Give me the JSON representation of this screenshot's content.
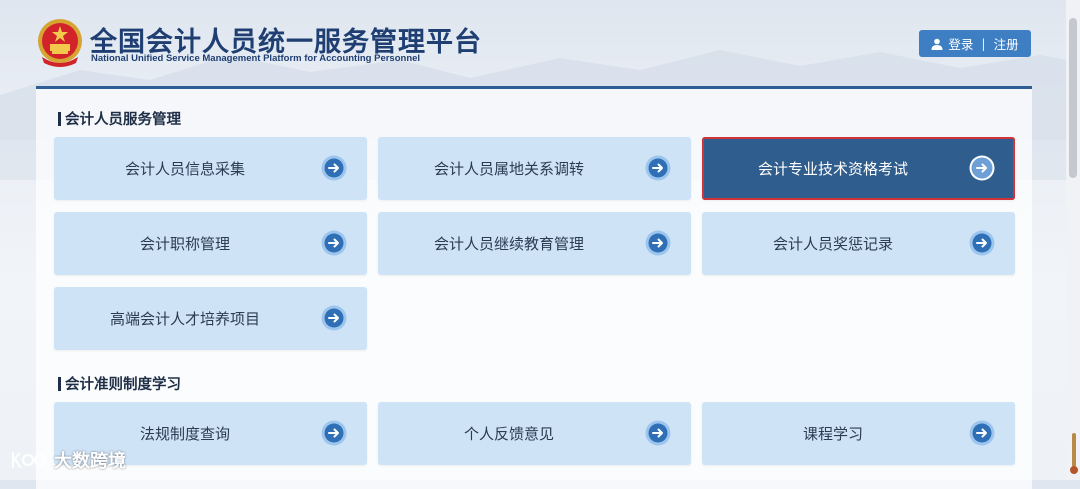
{
  "header": {
    "title_cn": "全国会计人员统一服务管理平台",
    "title_en": "National Unified Service Management Platform for Accounting Personnel",
    "login_label": "登录",
    "register_label": "注册",
    "separator": "|"
  },
  "sections": [
    {
      "title": "会计人员服务管理",
      "cards": [
        {
          "label": "会计人员信息采集",
          "active": false
        },
        {
          "label": "会计人员属地关系调转",
          "active": false
        },
        {
          "label": "会计专业技术资格考试",
          "active": true
        },
        {
          "label": "会计职称管理",
          "active": false
        },
        {
          "label": "会计人员继续教育管理",
          "active": false
        },
        {
          "label": "会计人员奖惩记录",
          "active": false
        },
        {
          "label": "高端会计人才培养项目",
          "active": false
        }
      ]
    },
    {
      "title": "会计准则制度学习",
      "cards": [
        {
          "label": "法规制度查询",
          "active": false
        },
        {
          "label": "个人反馈意见",
          "active": false
        },
        {
          "label": "课程学习",
          "active": false
        }
      ]
    }
  ],
  "watermark": {
    "text": "大数跨境",
    "logo": "koo-logo-icon"
  },
  "colors": {
    "brand_blue": "#1f3f73",
    "card_bg": "#cfe3f7",
    "card_active_bg": "#2f5d8d",
    "active_outline": "#d2333a",
    "login_btn": "#3e7fc4"
  },
  "icons": [
    "national-emblem-icon",
    "user-icon",
    "arrow-right-circle-icon"
  ]
}
